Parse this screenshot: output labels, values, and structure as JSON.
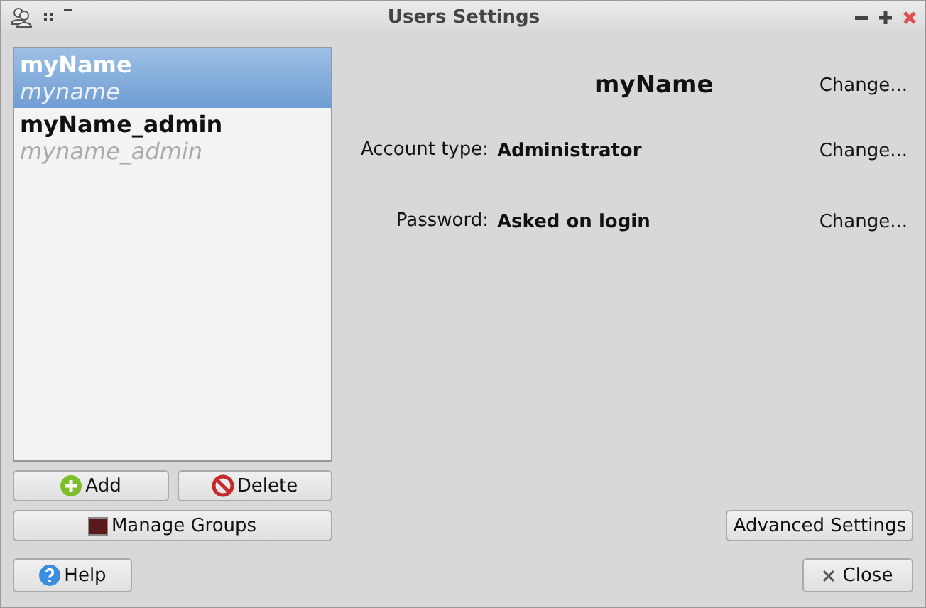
{
  "window": {
    "title": "Users Settings"
  },
  "users": [
    {
      "name": "myName",
      "login": "myname",
      "selected": true
    },
    {
      "name": "myName_admin",
      "login": "myname_admin",
      "selected": false
    }
  ],
  "list_buttons": [
    {
      "kind": "add",
      "label": "Add"
    },
    {
      "kind": "delete",
      "label": "Delete"
    }
  ],
  "manage_groups": {
    "label": "Manage Groups"
  },
  "details": {
    "name": "myName",
    "name_action": "Change...",
    "fields": [
      {
        "label": "Account type:",
        "value": "Administrator",
        "action": "Change..."
      },
      {
        "label": "Password:",
        "value": "Asked on login",
        "action": "Change..."
      }
    ]
  },
  "advanced": {
    "label": "Advanced Settings"
  },
  "help": {
    "label": "Help"
  },
  "close": {
    "label": "Close"
  }
}
